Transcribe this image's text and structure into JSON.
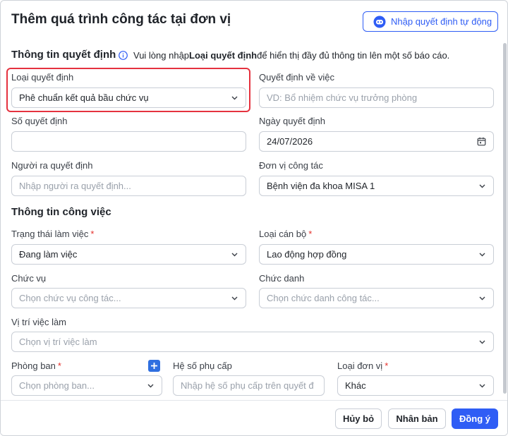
{
  "dialog": {
    "title": "Thêm quá trình công tác tại đơn vị",
    "auto_import_label": "Nhập quyết định tự động"
  },
  "decision_section": {
    "title": "Thông tin quyết định",
    "info_prefix": "Vui lòng nhập ",
    "info_bold": "Loại quyết định",
    "info_suffix": " để hiển thị đầy đủ thông tin lên một số báo cáo.",
    "decision_type": {
      "label": "Loại quyết định",
      "value": "Phê chuẩn kết quả bầu chức vụ"
    },
    "subject": {
      "label": "Quyết định về việc",
      "placeholder": "VD: Bổ nhiệm chức vụ trưởng phòng"
    },
    "decision_number": {
      "label": "Số quyết định",
      "value": ""
    },
    "decision_date": {
      "label": "Ngày quyết định",
      "value": "24/07/2026"
    },
    "issuer": {
      "label": "Người ra quyết định",
      "placeholder": "Nhập người ra quyết định..."
    },
    "work_unit": {
      "label": "Đơn vị công tác",
      "value": "Bệnh viện đa khoa MISA 1"
    }
  },
  "work_section": {
    "title": "Thông tin công việc",
    "work_status": {
      "label": "Trạng thái làm việc",
      "required": "*",
      "value": "Đang làm việc"
    },
    "staff_type": {
      "label": "Loại cán bộ",
      "required": "*",
      "value": "Lao động hợp đồng"
    },
    "position": {
      "label": "Chức vụ",
      "placeholder": "Chọn chức vụ công tác..."
    },
    "title_rank": {
      "label": "Chức danh",
      "placeholder": "Chọn chức danh công tác..."
    },
    "job_location": {
      "label": "Vị trí việc làm",
      "placeholder": "Chọn vị trí việc làm"
    },
    "department": {
      "label": "Phòng ban",
      "required": "*",
      "placeholder": "Chọn phòng ban..."
    },
    "allowance": {
      "label": "Hệ số phụ cấp",
      "placeholder": "Nhập hệ số phụ cấp trên quyết đ"
    },
    "unit_type": {
      "label": "Loại đơn vị",
      "required": "*",
      "value": "Khác"
    }
  },
  "footer": {
    "cancel_label": "Hủy bỏ",
    "duplicate_label": "Nhân bản",
    "confirm_label": "Đồng ý"
  },
  "colors": {
    "primary": "#2f5df5",
    "highlight": "#e5323f",
    "required": "#e5322d"
  },
  "icons": [
    "robot-icon",
    "info-icon",
    "chevron-down-icon",
    "calendar-icon",
    "plus-icon"
  ]
}
